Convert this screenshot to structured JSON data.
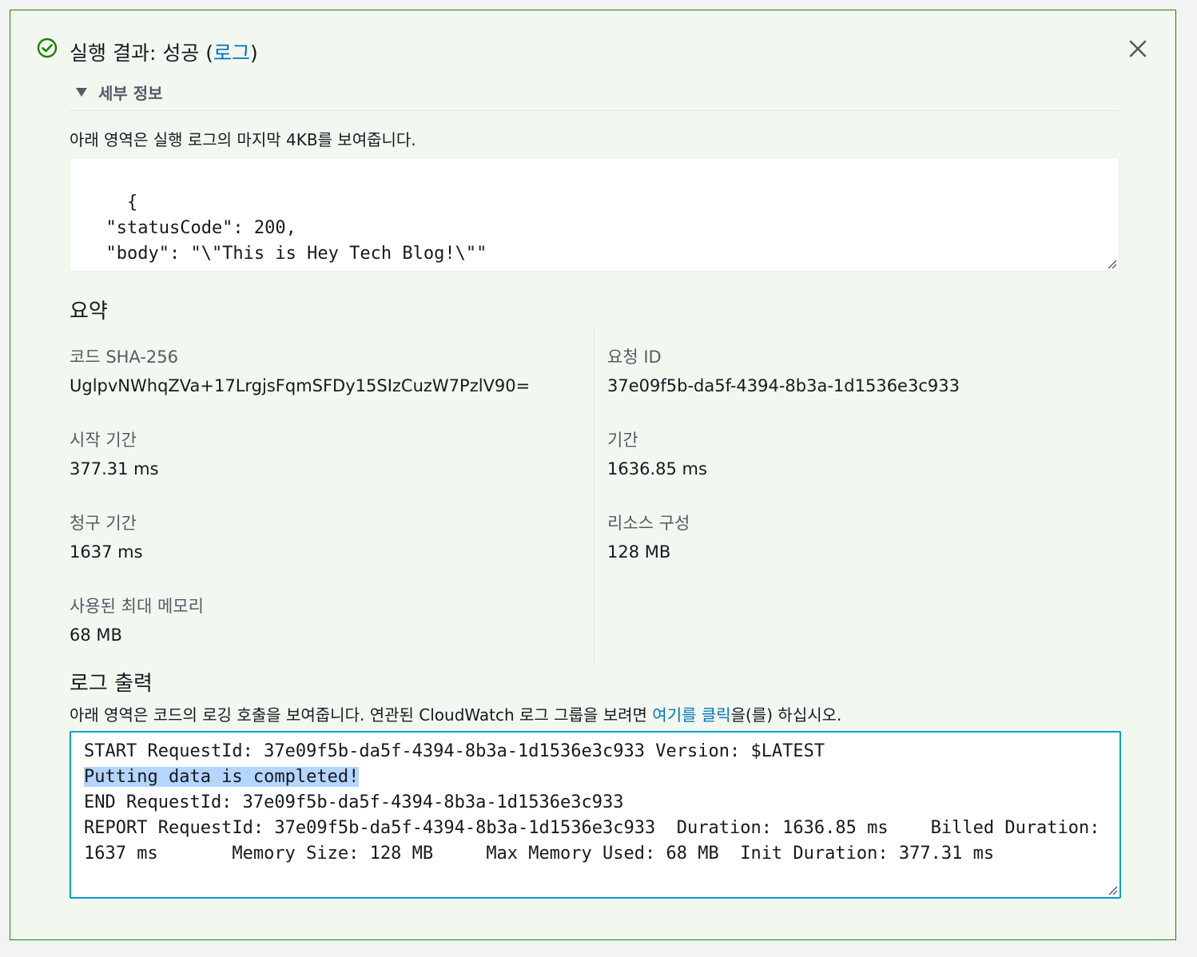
{
  "header": {
    "title_prefix": "실행 결과: 성공 (",
    "log_link": "로그",
    "title_suffix": ")",
    "details_toggle": "세부 정보"
  },
  "result": {
    "description": "아래 영역은 실행 로그의 마지막 4KB를 보여줍니다.",
    "output": "{\n  \"statusCode\": 200,\n  \"body\": \"\\\"This is Hey Tech Blog!\\\"\"\n}"
  },
  "summary": {
    "heading": "요약",
    "code_sha_label": "코드 SHA-256",
    "code_sha_value": "UglpvNWhqZVa+17LrgjsFqmSFDy15SIzCuzW7PzlV90=",
    "request_id_label": "요청 ID",
    "request_id_value": "37e09f5b-da5f-4394-8b3a-1d1536e3c933",
    "init_duration_label": "시작 기간",
    "init_duration_value": "377.31 ms",
    "duration_label": "기간",
    "duration_value": "1636.85 ms",
    "billed_duration_label": "청구 기간",
    "billed_duration_value": "1637 ms",
    "resources_label": "리소스 구성",
    "resources_value": "128 MB",
    "max_memory_label": "사용된 최대 메모리",
    "max_memory_value": "68 MB"
  },
  "log_output": {
    "heading": "로그 출력",
    "description_prefix": "아래 영역은 코드의 로깅 호출을 보여줍니다. 연관된 CloudWatch 로그 그룹을 보려면 ",
    "description_link": "여기를 클릭",
    "description_suffix": "을(를) 하십시오.",
    "line1": "START RequestId: 37e09f5b-da5f-4394-8b3a-1d1536e3c933 Version: $LATEST",
    "line2": "Putting data is completed!",
    "line3": "END RequestId: 37e09f5b-da5f-4394-8b3a-1d1536e3c933",
    "line4": "REPORT RequestId: 37e09f5b-da5f-4394-8b3a-1d1536e3c933  Duration: 1636.85 ms    Billed Duration: 1637 ms       Memory Size: 128 MB     Max Memory Used: 68 MB  Init Duration: 377.31 ms"
  },
  "colors": {
    "success": "#1d8102",
    "link": "#0073bb",
    "focus_border": "#00a1c9",
    "selection": "#b4d5fe"
  }
}
